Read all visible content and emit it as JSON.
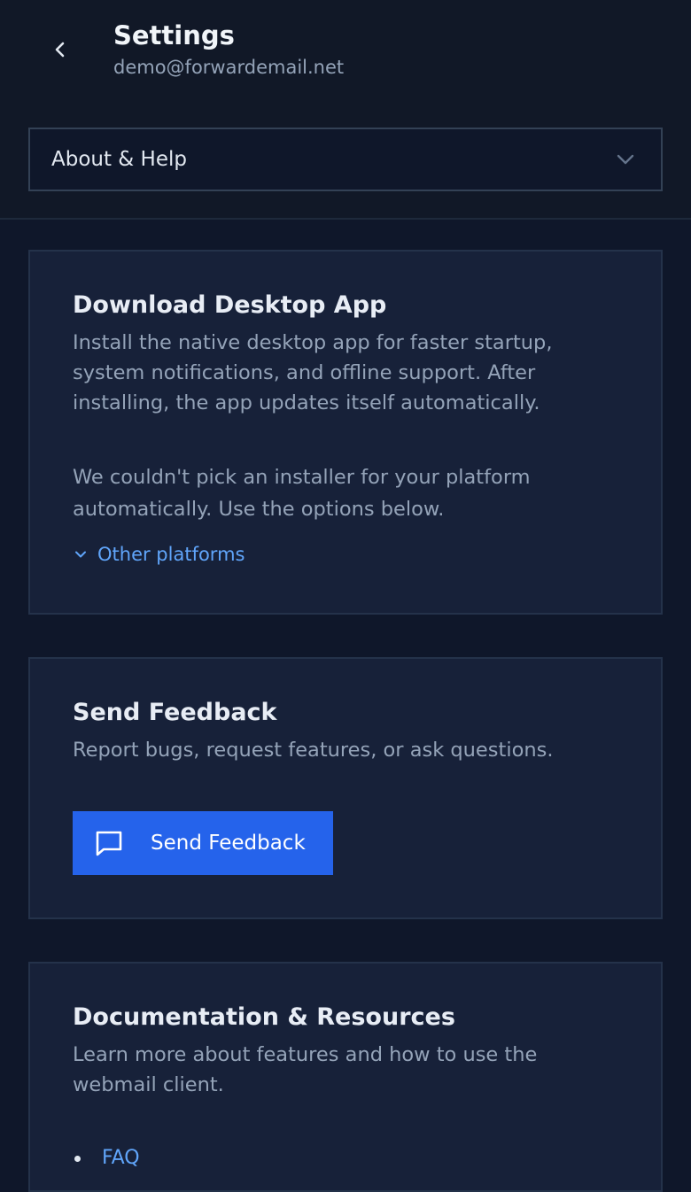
{
  "header": {
    "title": "Settings",
    "subtitle": "demo@forwardemail.net",
    "back_icon": "chevron-left-icon"
  },
  "section_select": {
    "value": "About & Help",
    "icon": "chevron-down-icon"
  },
  "desktop_app": {
    "title": "Download Desktop App",
    "description": "Install the native desktop app for faster startup, system notifications, and offline support. After installing, the app updates itself automatically.",
    "notice": "We couldn't pick an installer for your platform automatically. Use the options below.",
    "other_platforms_label": "Other platforms"
  },
  "feedback": {
    "title": "Send Feedback",
    "description": "Report bugs, request features, or ask questions.",
    "button_label": "Send Feedback",
    "button_icon": "message-square-icon"
  },
  "docs": {
    "title": "Documentation & Resources",
    "description": "Learn more about features and how to use the webmail client.",
    "links": [
      "FAQ"
    ]
  },
  "colors": {
    "background": "#0f172a",
    "card": "#172139",
    "accent": "#2563eb",
    "link": "#60a5fa"
  }
}
